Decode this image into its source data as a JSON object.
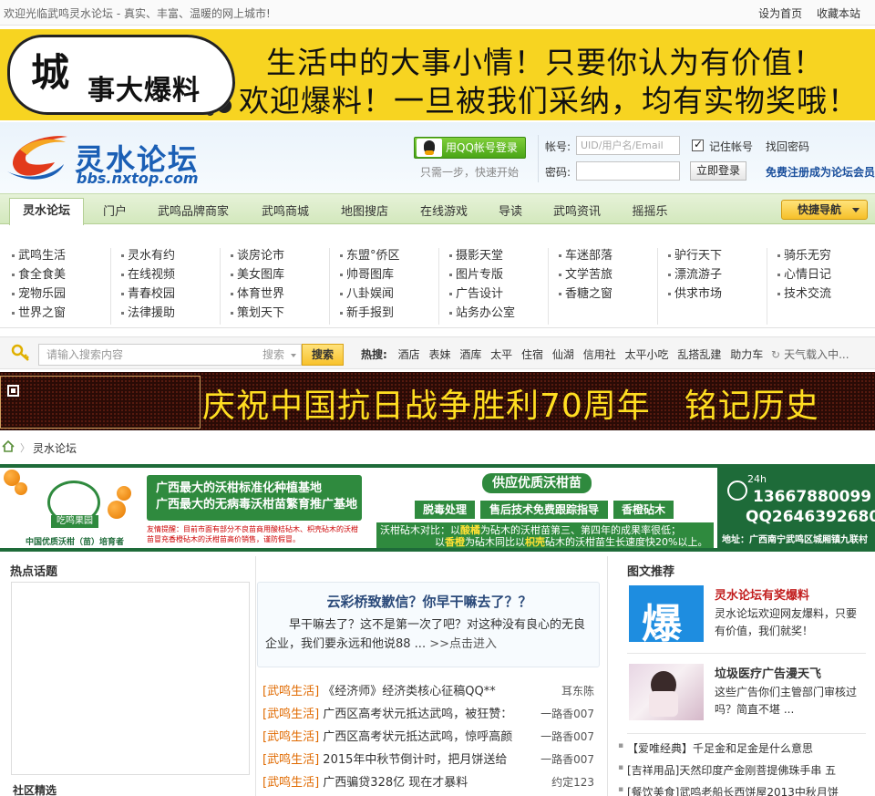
{
  "topbar": {
    "welcome": "欢迎光临武鸣灵水论坛 - 真实、丰富、温暖的网上城市!",
    "set_home": "设为首页",
    "bookmark": "收藏本站"
  },
  "promo": {
    "tag_big": "城",
    "tag_small": "事大爆料",
    "line1": "生活中的大事小情！只要你认为有价值！",
    "line2": "欢迎爆料！一旦被我们采纳，均有实物奖哦！"
  },
  "header": {
    "logo_title": "灵水论坛",
    "logo_url": "bbs.nxtop.com",
    "qq_login": "用QQ帐号登录",
    "qq_note": "只需一步，快速开始",
    "account_label": "帐号:",
    "account_placeholder": "UID/用户名/Email",
    "remember": "记住帐号",
    "find_password": "找回密码",
    "password_label": "密码:",
    "login_button": "立即登录",
    "register": "免费注册成为论坛会员"
  },
  "nav": {
    "tabs": [
      "灵水论坛",
      "门户",
      "武鸣品牌商家",
      "武鸣商城",
      "地图搜店",
      "在线游戏",
      "导读",
      "武鸣资讯",
      "摇摇乐"
    ],
    "quick": "快捷导航"
  },
  "forums": [
    [
      "武鸣生活",
      "食全食美",
      "宠物乐园",
      "世界之窗"
    ],
    [
      "灵水有约",
      "在线视频",
      "青春校园",
      "法律援助"
    ],
    [
      "谈房论市",
      "美女图库",
      "体育世界",
      "策划天下"
    ],
    [
      "东盟°侨区",
      "帅哥图库",
      "八卦娱闻",
      "新手报到"
    ],
    [
      "摄影天堂",
      "图片专版",
      "广告设计",
      "站务办公室"
    ],
    [
      "车迷部落",
      "文学苦旅",
      "香糖之窗"
    ],
    [
      "驴行天下",
      "漂流游子",
      "供求市场"
    ],
    [
      "骑乐无穷",
      "心情日记",
      "技术交流"
    ]
  ],
  "search": {
    "placeholder": "请输入搜索内容",
    "type": "搜索",
    "button": "搜索",
    "hot_label": "热搜:",
    "hot": [
      "酒店",
      "表妹",
      "酒库",
      "太平",
      "住宿",
      "仙湖",
      "信用社",
      "太平小吃",
      "乱搭乱建",
      "助力车"
    ],
    "weather": "天气载入中..."
  },
  "celebrate": {
    "text": "庆祝中国抗日战争胜利70周年　铭记历史"
  },
  "breadcrumb": {
    "current": "灵水论坛"
  },
  "green_ad": {
    "logo_label": "吃鸣果园",
    "caption": "中国优质沃柑（苗）培育者",
    "slogan1": "广西最大的沃柑标准化种植基地",
    "slogan2": "广西最大的无病毒沃柑苗繁育推广基地",
    "notice": "友情提醒：目前市面有部分不良苗商用酸桔砧木、枳壳砧木的沃柑苗冒充香橙砧木的沃柑苗高价销售，谨防假冒。",
    "supply": "供应优质沃柑苗",
    "chips": [
      "脱毒处理",
      "售后技术免费跟踪指导",
      "香橙砧木"
    ],
    "compare_label": "沃柑砧木对比：",
    "compare1_pre": "以",
    "compare1_hl": "酸橘",
    "compare1_post": "为砧木的沃柑苗第三、第四年的成果率很低；",
    "compare2_pre": "以",
    "compare2_hl": "香橙",
    "compare2_mid": "为砧木同比以",
    "compare2_hl2": "枳壳",
    "compare2_post": "砧木的沃柑苗生长速度快20%以上。",
    "hours": "24h",
    "phone": "13667880099",
    "qq": "QQ2646392680",
    "address": "地址：广西南宁武鸣区城厢镇九联村"
  },
  "hot_topics": {
    "title": "热点话题",
    "community": "社区精选"
  },
  "center": {
    "feature_title": "云彩桥致歉信？你早干嘛去了？？",
    "feature_body": "早干嘛去了？这不是第一次了吧？对这种没有良心的无良企业，我们要永远和他说88 ...",
    "feature_more": ">>点击进入",
    "news": [
      {
        "cat": "[武鸣生活]",
        "title": "《经济师》经济类核心征稿QQ**",
        "author": "耳东陈"
      },
      {
        "cat": "[武鸣生活]",
        "title": "广西区高考状元抵达武鸣，被狂赞：",
        "author": "一路香007"
      },
      {
        "cat": "[武鸣生活]",
        "title": "广西区高考状元抵达武鸣，惊呼高颜",
        "author": "一路香007"
      },
      {
        "cat": "[武鸣生活]",
        "title": "2015年中秋节倒计时，把月饼送给",
        "author": "一路香007"
      },
      {
        "cat": "[武鸣生活]",
        "title": "广西骗贷328亿 现在才暴料",
        "author": "约定123"
      }
    ]
  },
  "right": {
    "title": "图文推荐",
    "item1_thumb": "爆",
    "item1_title": "灵水论坛有奖爆料",
    "item1_desc": "灵水论坛欢迎网友爆料，只要有价值，我们就奖！",
    "item2_title": "垃圾医疗广告漫天飞",
    "item2_desc": "这些广告你们主管部门审核过吗？简直不堪 ...",
    "list": [
      "【爱唯经典】千足金和足金是什么意思",
      "[吉祥用品]天然印度产金刚菩提佛珠手串 五",
      "[餐饮美食]武鸣老船长西饼屋2013中秋月饼"
    ]
  },
  "colors": {
    "promo_yellow": "#f7d421",
    "nav_green": "#d3e8bd",
    "led_yellow": "#ffde21",
    "ad_green": "#1e6b39",
    "category_orange": "#e06a00",
    "recommend_red": "#c21f1f"
  }
}
